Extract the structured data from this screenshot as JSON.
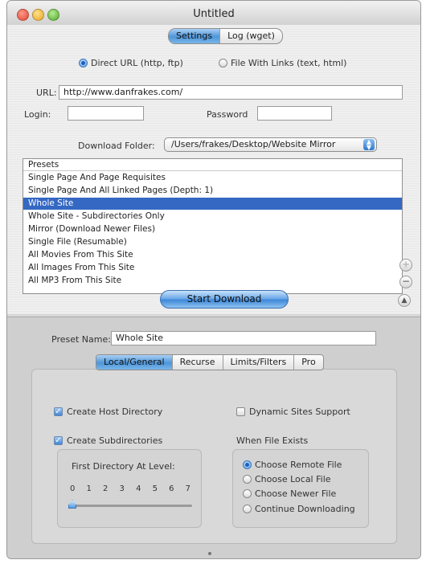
{
  "window": {
    "title": "Untitled"
  },
  "top_tabs": [
    {
      "label": "Settings",
      "selected": true
    },
    {
      "label": "Log (wget)",
      "selected": false
    }
  ],
  "source": {
    "option_direct": "Direct URL (http, ftp)",
    "option_file": "File With Links (text, html)",
    "selected": "direct"
  },
  "url": {
    "label": "URL:",
    "value": "http://www.danfrakes.com/"
  },
  "login": {
    "label": "Login:",
    "value": ""
  },
  "password": {
    "label": "Password",
    "value": ""
  },
  "download_folder": {
    "label": "Download Folder:",
    "value": "/Users/frakes/Desktop/Website Mirror"
  },
  "presets": {
    "header": "Presets",
    "items": [
      "Single Page And Page Requisites",
      "Single Page And All Linked Pages (Depth: 1)",
      "Whole Site",
      "Whole Site - Subdirectories Only",
      "Mirror (Download Newer Files)",
      "Single File (Resumable)",
      "All Movies From This Site",
      "All Images From This Site",
      "All MP3 From This Site"
    ],
    "selected_index": 2
  },
  "start_button": "Start Download",
  "preset_name": {
    "label": "Preset Name:",
    "value": "Whole Site"
  },
  "sub_tabs": [
    {
      "label": "Local/General",
      "selected": true
    },
    {
      "label": "Recurse",
      "selected": false
    },
    {
      "label": "Limits/Filters",
      "selected": false
    },
    {
      "label": "Pro",
      "selected": false
    }
  ],
  "options": {
    "create_host_directory": {
      "label": "Create Host Directory",
      "checked": true
    },
    "dynamic_sites_support": {
      "label": "Dynamic Sites Support",
      "checked": false
    },
    "create_subdirectories": {
      "label": "Create Subdirectories",
      "checked": true
    }
  },
  "first_directory": {
    "label": "First Directory At Level:",
    "ticks": [
      "0",
      "1",
      "2",
      "3",
      "4",
      "5",
      "6",
      "7"
    ],
    "value": 0
  },
  "when_file_exists": {
    "label": "When File Exists",
    "options": [
      "Choose Remote File",
      "Choose Local File",
      "Choose Newer File",
      "Continue Downloading"
    ],
    "selected_index": 0
  },
  "colors": {
    "selection": "#3568c3",
    "accent": "#4d95d9"
  }
}
